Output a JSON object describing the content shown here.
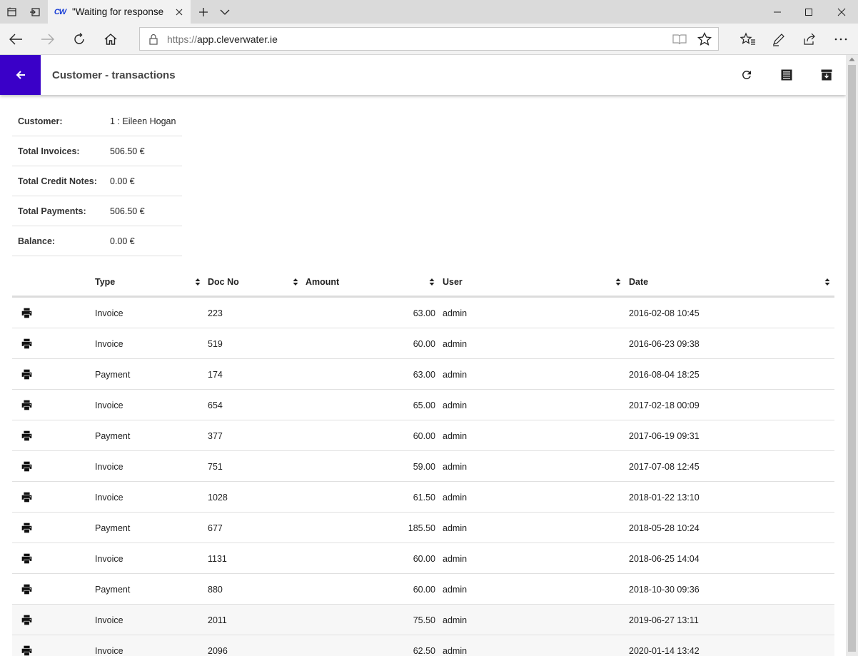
{
  "browser": {
    "tab_title": "\"Waiting for response fr",
    "favicon_text": "CW",
    "url_protocol": "https://",
    "url_host": "app.cleverwater.ie"
  },
  "app": {
    "title": "Customer - transactions",
    "accent_color": "#3a00c8"
  },
  "summary": [
    {
      "label": "Customer:",
      "value": "1 : Eileen Hogan"
    },
    {
      "label": "Total Invoices:",
      "value": "506.50 €"
    },
    {
      "label": "Total Credit Notes:",
      "value": "0.00 €"
    },
    {
      "label": "Total Payments:",
      "value": "506.50 €"
    },
    {
      "label": "Balance:",
      "value": "0.00 €"
    }
  ],
  "table": {
    "headers": {
      "type": "Type",
      "doc_no": "Doc No",
      "amount": "Amount",
      "user": "User",
      "date": "Date"
    },
    "rows": [
      {
        "type": "Invoice",
        "doc_no": "223",
        "amount": "63.00",
        "user": "admin",
        "date": "2016-02-08 10:45"
      },
      {
        "type": "Invoice",
        "doc_no": "519",
        "amount": "60.00",
        "user": "admin",
        "date": "2016-06-23 09:38"
      },
      {
        "type": "Payment",
        "doc_no": "174",
        "amount": "63.00",
        "user": "admin",
        "date": "2016-08-04 18:25"
      },
      {
        "type": "Invoice",
        "doc_no": "654",
        "amount": "65.00",
        "user": "admin",
        "date": "2017-02-18 00:09"
      },
      {
        "type": "Payment",
        "doc_no": "377",
        "amount": "60.00",
        "user": "admin",
        "date": "2017-06-19 09:31"
      },
      {
        "type": "Invoice",
        "doc_no": "751",
        "amount": "59.00",
        "user": "admin",
        "date": "2017-07-08 12:45"
      },
      {
        "type": "Invoice",
        "doc_no": "1028",
        "amount": "61.50",
        "user": "admin",
        "date": "2018-01-22 13:10"
      },
      {
        "type": "Payment",
        "doc_no": "677",
        "amount": "185.50",
        "user": "admin",
        "date": "2018-05-28 10:24"
      },
      {
        "type": "Invoice",
        "doc_no": "1131",
        "amount": "60.00",
        "user": "admin",
        "date": "2018-06-25 14:04"
      },
      {
        "type": "Payment",
        "doc_no": "880",
        "amount": "60.00",
        "user": "admin",
        "date": "2018-10-30 09:36"
      },
      {
        "type": "Invoice",
        "doc_no": "2011",
        "amount": "75.50",
        "user": "admin",
        "date": "2019-06-27 13:11"
      },
      {
        "type": "Invoice",
        "doc_no": "2096",
        "amount": "62.50",
        "user": "admin",
        "date": "2020-01-14 13:42"
      }
    ]
  }
}
